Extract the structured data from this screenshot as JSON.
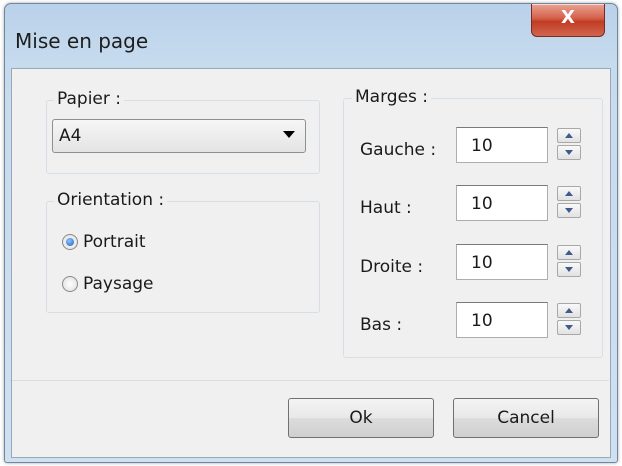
{
  "window": {
    "title": "Mise en page",
    "close_label": "X"
  },
  "paper": {
    "legend": "Papier :",
    "selected": "A4"
  },
  "orientation": {
    "legend": "Orientation :",
    "options": [
      {
        "label": "Portrait",
        "checked": true
      },
      {
        "label": "Paysage",
        "checked": false
      }
    ]
  },
  "margins": {
    "legend": "Marges :",
    "fields": [
      {
        "label": "Gauche :",
        "value": "10"
      },
      {
        "label": "Haut :",
        "value": "10"
      },
      {
        "label": "Droite :",
        "value": "10"
      },
      {
        "label": "Bas :",
        "value": "10"
      }
    ]
  },
  "buttons": {
    "ok": "Ok",
    "cancel": "Cancel"
  },
  "colors": {
    "titlebar": "#b9d1ea",
    "close": "#c23b24",
    "client": "#f0f0f0"
  }
}
